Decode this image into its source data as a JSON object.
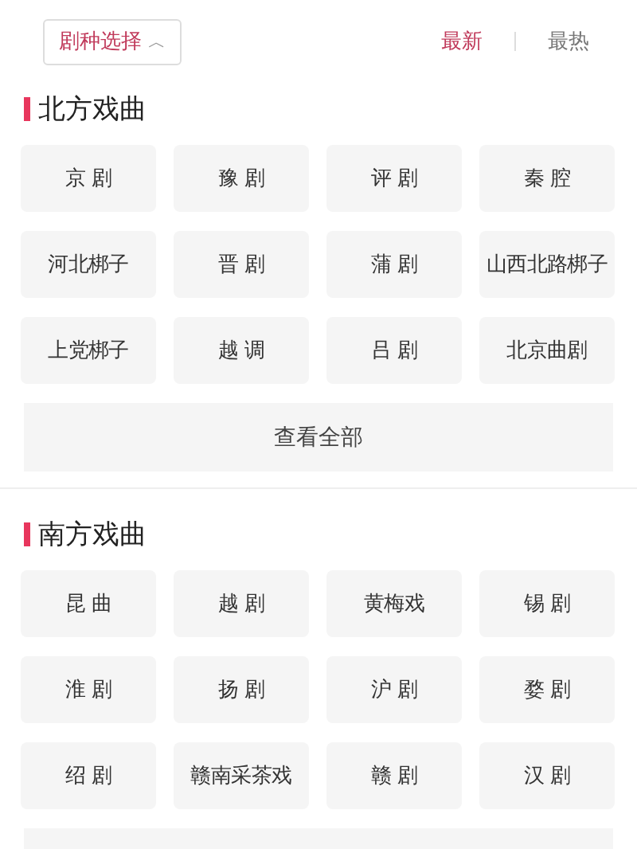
{
  "filter_button": {
    "label": "剧种选择",
    "caret": "︿"
  },
  "sort_tabs": [
    {
      "label": "最新",
      "selected": true
    },
    {
      "label": "最热",
      "selected": false
    }
  ],
  "sections": [
    {
      "title": "北方戏曲",
      "items": [
        "京 剧",
        "豫 剧",
        "评 剧",
        "秦 腔",
        "河北梆子",
        "晋 剧",
        "蒲 剧",
        "山西北路梆子",
        "上党梆子",
        "越 调",
        "吕 剧",
        "北京曲剧"
      ],
      "view_all": "查看全部"
    },
    {
      "title": "南方戏曲",
      "items": [
        "昆 曲",
        "越 剧",
        "黄梅戏",
        "锡 剧",
        "淮 剧",
        "扬 剧",
        "沪 剧",
        "婺 剧",
        "绍 剧",
        "赣南采茶戏",
        "赣 剧",
        "汉 剧"
      ]
    }
  ]
}
